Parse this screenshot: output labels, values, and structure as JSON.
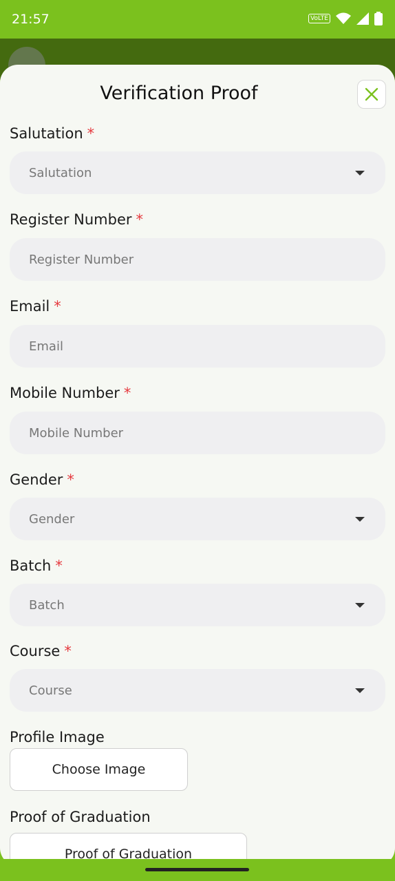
{
  "status": {
    "time": "21:57",
    "volte": "VoLTE",
    "icons": [
      "wifi-icon",
      "signal-icon",
      "battery-icon"
    ]
  },
  "sheet": {
    "title": "Verification Proof",
    "close_icon": "close-icon"
  },
  "required_mark": "*",
  "fields": {
    "salutation": {
      "label": "Salutation",
      "placeholder": "Salutation"
    },
    "register": {
      "label": "Register Number",
      "placeholder": "Register Number"
    },
    "email": {
      "label": "Email",
      "placeholder": "Email"
    },
    "mobile": {
      "label": "Mobile Number",
      "placeholder": "Mobile Number"
    },
    "gender": {
      "label": "Gender",
      "placeholder": "Gender"
    },
    "batch": {
      "label": "Batch",
      "placeholder": "Batch"
    },
    "course": {
      "label": "Course",
      "placeholder": "Course"
    }
  },
  "profile_image": {
    "label": "Profile Image",
    "button": "Choose Image"
  },
  "proof": {
    "label": "Proof of Graduation",
    "button": "Proof of Graduation"
  },
  "colors": {
    "brand_green": "#7bc11e",
    "dark_green": "#446a0f",
    "required_red": "#e5393e"
  }
}
